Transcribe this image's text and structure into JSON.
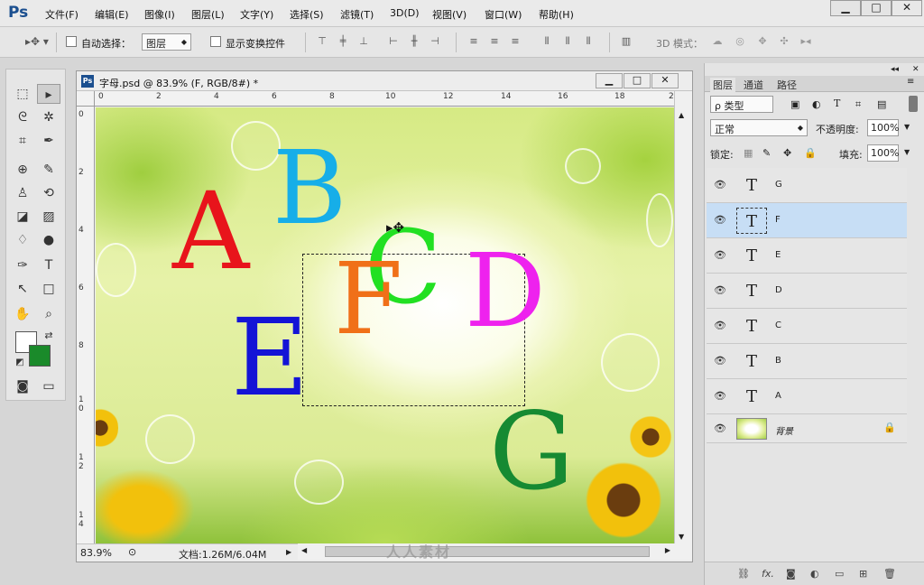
{
  "app": {
    "logo": "Ps"
  },
  "menu": [
    "文件(F)",
    "编辑(E)",
    "图像(I)",
    "图层(L)",
    "文字(Y)",
    "选择(S)",
    "滤镜(T)",
    "3D(D)",
    "视图(V)",
    "窗口(W)",
    "帮助(H)"
  ],
  "window_controls": {
    "minimize": "▁",
    "maximize": "□",
    "close": "✕"
  },
  "options": {
    "auto_select_label": "自动选择：",
    "auto_select_value": "图层",
    "show_transform_label": "显示变换控件",
    "mode_3d_label": "3D 模式："
  },
  "document": {
    "title": "字母.psd @ 83.9% (F, RGB/8#) *",
    "zoom": "83.9%",
    "info": "文档:1.26M/6.04M",
    "ruler_top": [
      "0",
      "2",
      "4",
      "6",
      "8",
      "10",
      "12",
      "14",
      "16",
      "18",
      "2"
    ],
    "ruler_left": [
      "0",
      "2",
      "4",
      "6",
      "8",
      "10",
      "12",
      "14"
    ]
  },
  "canvas_letters": [
    {
      "char": "A",
      "color": "#e8141b"
    },
    {
      "char": "B",
      "color": "#16aee8"
    },
    {
      "char": "C",
      "color": "#22e022"
    },
    {
      "char": "D",
      "color": "#ee22ee"
    },
    {
      "char": "E",
      "color": "#1414d6"
    },
    {
      "char": "F",
      "color": "#f07018"
    },
    {
      "char": "G",
      "color": "#168a32"
    }
  ],
  "panel": {
    "tabs": [
      "图层",
      "通道",
      "路径"
    ],
    "filter_kind": "ρ 类型",
    "blend_mode": "正常",
    "opacity_label": "不透明度:",
    "opacity_value": "100%",
    "lock_label": "锁定:",
    "fill_label": "填充:",
    "fill_value": "100%"
  },
  "layers": [
    {
      "name": "G",
      "thumb": "T",
      "selected": false
    },
    {
      "name": "F",
      "thumb": "T",
      "selected": true
    },
    {
      "name": "E",
      "thumb": "T",
      "selected": false
    },
    {
      "name": "D",
      "thumb": "T",
      "selected": false
    },
    {
      "name": "C",
      "thumb": "T",
      "selected": false
    },
    {
      "name": "B",
      "thumb": "T",
      "selected": false
    },
    {
      "name": "A",
      "thumb": "T",
      "selected": false
    },
    {
      "name": "背景",
      "thumb": "",
      "selected": false,
      "locked": true
    }
  ],
  "colors": {
    "foreground": "#ffffff",
    "background": "#1a8a2a"
  },
  "watermark": "人人素材"
}
